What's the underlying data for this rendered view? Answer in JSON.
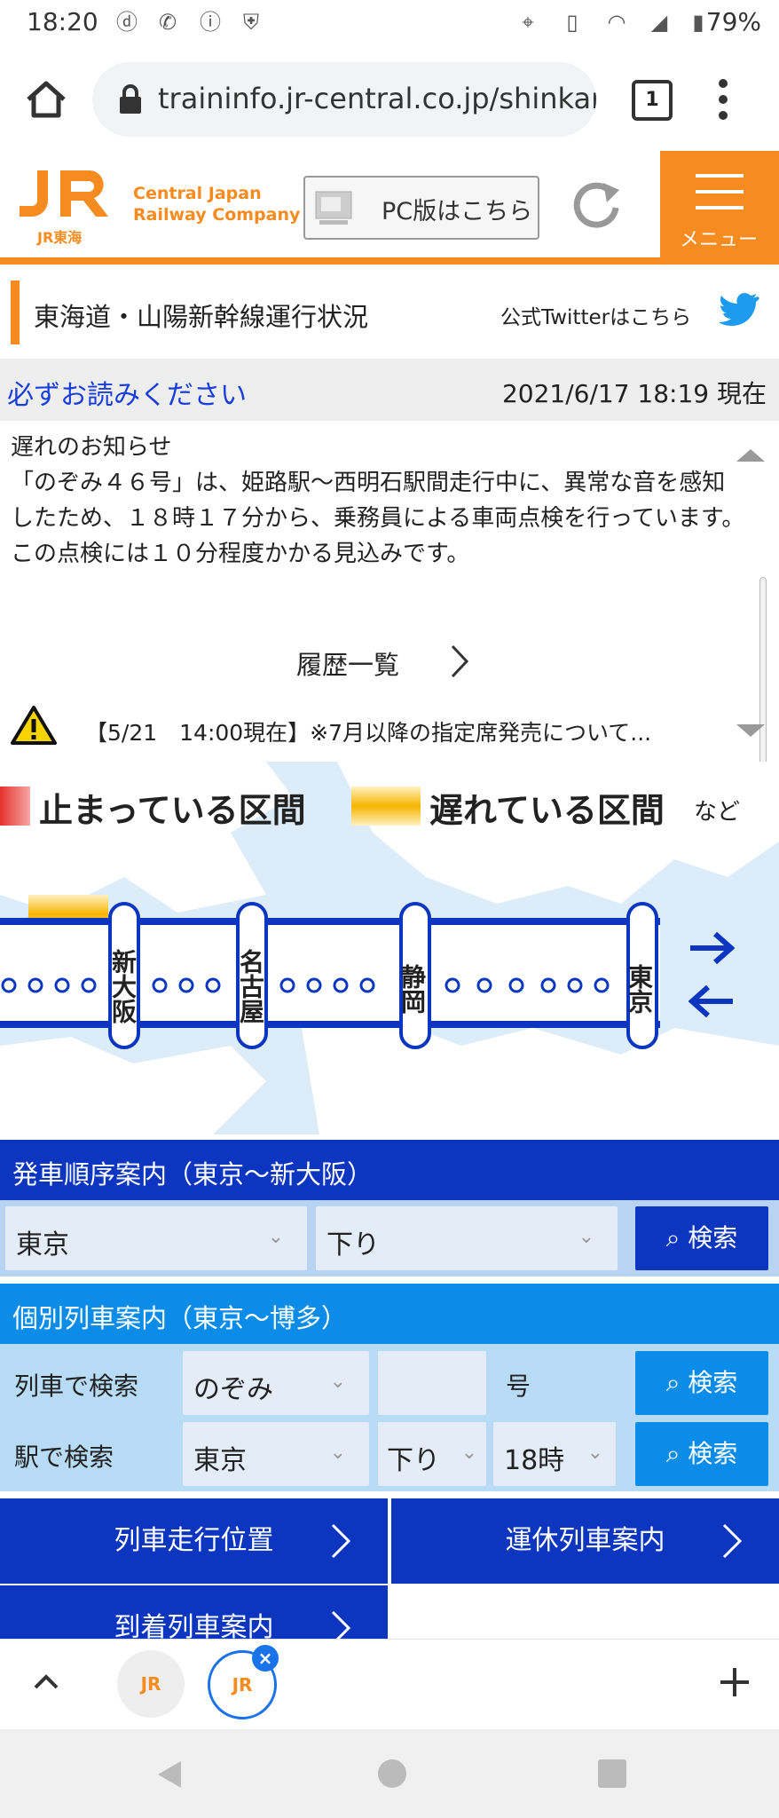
{
  "status_bar": {
    "time": "18:20",
    "battery": "79%",
    "icons": [
      "docomo-icon",
      "wifi-calling-icon",
      "info-icon",
      "shield-icon",
      "location-icon",
      "vibrate-icon",
      "wifi-icon",
      "signal-icon",
      "battery-icon"
    ]
  },
  "browser": {
    "url": "traininfo.jr-central.co.jp/shinkan",
    "tab_count": "1"
  },
  "header": {
    "logo_jr": "JR",
    "logo_sub": "JR東海",
    "company_line1": "Central Japan",
    "company_line2": "Railway Company",
    "pc_button": "PC版はこちら",
    "menu_label": "メニュー"
  },
  "title_bar": {
    "title": "東海道・山陽新幹線運行状況",
    "twitter_link": "公式Twitterはこちら"
  },
  "notice_bar": {
    "must_read": "必ずお読みください",
    "timestamp": "2021/6/17 18:19 現在"
  },
  "notice": {
    "heading": "遅れのお知らせ",
    "body": "「のぞみ４６号」は、姫路駅〜西明石駅間走行中に、異常な音を感知したため、１８時１７分から、乗務員による車両点検を行っています。\nこの点検には１０分程度かかる見込みです。",
    "history_link": "履歴一覧",
    "alert": "【5/21　14:00現在】※7月以降の指定席発売について..."
  },
  "map": {
    "legend_stopped": "止まっている区間",
    "legend_delayed": "遅れている区間",
    "legend_etc": "など",
    "stations": [
      "新大阪",
      "名古屋",
      "静岡",
      "東京"
    ],
    "colors": {
      "stopped": "#e5322d",
      "delayed": "#f7b500",
      "line": "#0c35c0"
    }
  },
  "departure": {
    "title": "発車順序案内（東京〜新大阪）",
    "station": "東京",
    "direction": "下り",
    "search": "検索"
  },
  "individual": {
    "title": "個別列車案内（東京〜博多）",
    "by_train_label": "列車で検索",
    "train_type": "のぞみ",
    "train_number": "",
    "go_suffix": "号",
    "by_station_label": "駅で検索",
    "station": "東京",
    "direction": "下り",
    "hour": "18時",
    "search": "検索"
  },
  "nav": {
    "position": "列車走行位置",
    "suspended": "運休列車案内",
    "arrival": "到着列車案内"
  },
  "tabbar": {
    "up_icon": "chevron-up-icon",
    "add_icon": "plus-icon",
    "tab_logo": "JR"
  }
}
